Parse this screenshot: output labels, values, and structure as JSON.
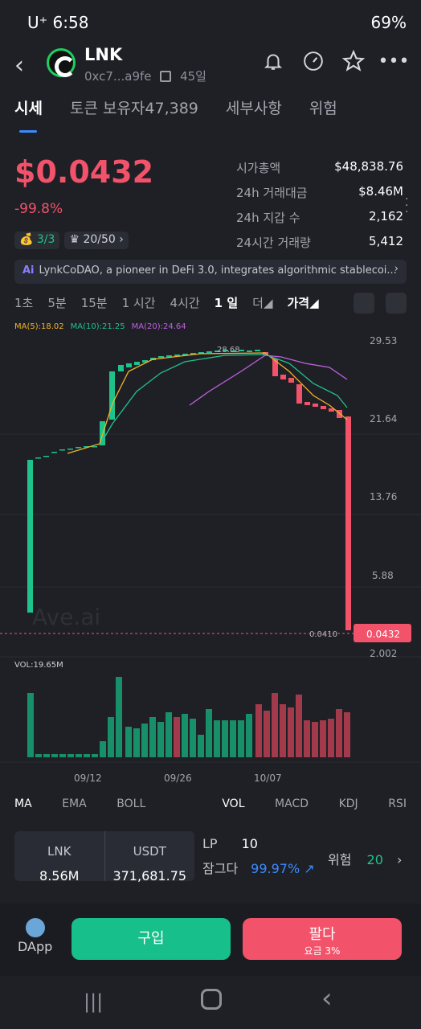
{
  "status": {
    "carrier": "U⁺ 6:58",
    "battery": "69%"
  },
  "header": {
    "token": "LNK",
    "address": "0xc7...a9fe",
    "age": "45일"
  },
  "tabs": [
    {
      "label": "시세",
      "active": true
    },
    {
      "label": "토큰 보유자47,389"
    },
    {
      "label": "세부사항"
    },
    {
      "label": "위험"
    }
  ],
  "price": "$0.0432",
  "change": "-99.8%",
  "pills": [
    {
      "label": "3/3"
    },
    {
      "label": "20/50"
    }
  ],
  "stats": [
    {
      "k": "시가총액",
      "v": "$48,838.76"
    },
    {
      "k": "24h 거래대금",
      "v": "$8.46M"
    },
    {
      "k": "24h 지갑 수",
      "v": "2,162"
    },
    {
      "k": "24시간 거래량",
      "v": "5,412"
    }
  ],
  "banner": {
    "ai": "Ai",
    "text": "LynkCoDAO, a pioneer in DeFi 3.0, integrates algorithmic stablecoi..."
  },
  "timeframes": [
    {
      "label": "1초"
    },
    {
      "label": "5분"
    },
    {
      "label": "15분"
    },
    {
      "label": "1 시간"
    },
    {
      "label": "4시간"
    },
    {
      "label": "1 일",
      "active": true
    },
    {
      "label": "더"
    },
    {
      "label": "가격"
    }
  ],
  "ma": {
    "ma5": "MA(5):18.02",
    "ma10": "MA(10):21.25",
    "ma20": "MA(20):24.64"
  },
  "chart_data": {
    "type": "candlestick",
    "y_ticks": [
      "29.53",
      "21.64",
      "13.76",
      "5.88",
      "2.002"
    ],
    "peak_label": "28.68",
    "last_price_label": "0.0432",
    "low_label": "0.0410",
    "x_ticks": [
      "09/12",
      "09/26",
      "10/07"
    ],
    "watermark": "Ave.ai",
    "volume_label": "VOL:19.65M"
  },
  "indicators": [
    {
      "label": "MA",
      "on": true
    },
    {
      "label": "EMA"
    },
    {
      "label": "BOLL"
    },
    {
      "label": "VOL",
      "on": true
    },
    {
      "label": "MACD"
    },
    {
      "label": "KDJ"
    },
    {
      "label": "RSI"
    }
  ],
  "pool": {
    "a_k": "LNK",
    "a_v": "8.56M",
    "b_k": "USDT",
    "b_v": "371,681.75"
  },
  "lp": {
    "k": "LP",
    "v": "10",
    "lock_k": "잠그다",
    "lock_v": "99.97%",
    "risk_k": "위험",
    "risk_v": "20"
  },
  "bottom": {
    "dapp": "DApp",
    "buy": "구입",
    "sell": "팔다",
    "fee": "요금 3%"
  },
  "colors": {
    "up": "#1fc28a",
    "down": "#f2536b",
    "accent": "#3a8bff"
  }
}
